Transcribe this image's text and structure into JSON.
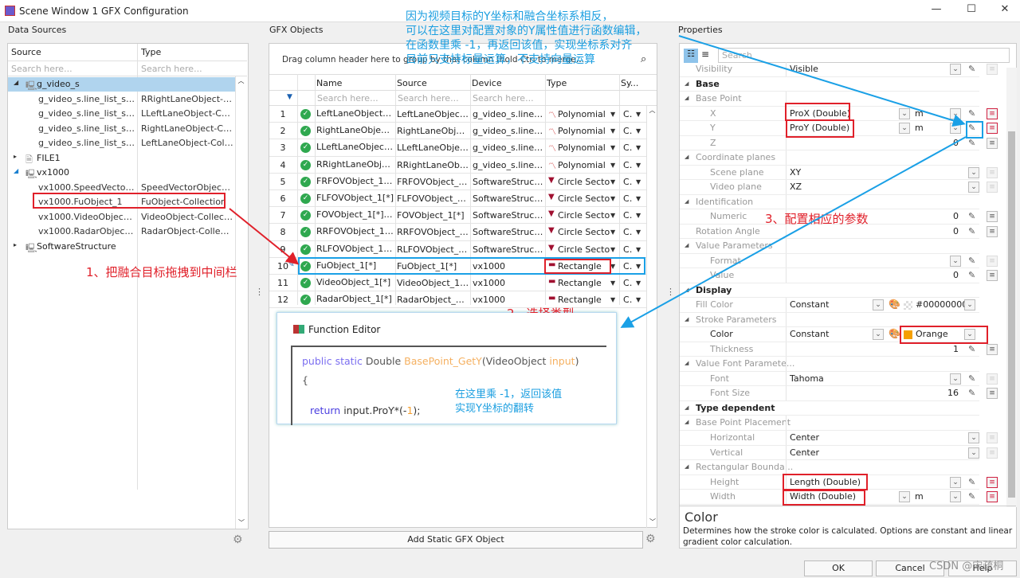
{
  "window": {
    "title": "Scene Window 1 GFX Configuration"
  },
  "data_sources": {
    "title": "Data Sources",
    "columns": [
      "Source",
      "Type"
    ],
    "search_placeholder": "Search here...",
    "tree": [
      {
        "source": "g_video_s",
        "type": "",
        "level": 0,
        "expander": "◢",
        "icon": "device",
        "selected": true
      },
      {
        "source": "g_video_s.line_list_s.li...",
        "type": "RRightLaneObject-C...",
        "level": 1
      },
      {
        "source": "g_video_s.line_list_s.li...",
        "type": "LLeftLaneObject-Col...",
        "level": 1
      },
      {
        "source": "g_video_s.line_list_s.li...",
        "type": "RightLaneObject-Col...",
        "level": 1
      },
      {
        "source": "g_video_s.line_list_s.li...",
        "type": "LeftLaneObject-Coll...",
        "level": 1
      },
      {
        "source": "FILE1",
        "type": "",
        "level": 0,
        "expander": "▸",
        "icon": "file"
      },
      {
        "source": "vx1000",
        "type": "",
        "level": 0,
        "expander": "◢",
        "icon": "device"
      },
      {
        "source": "vx1000.SpeedVector...",
        "type": "SpeedVectorObject-...",
        "level": 1
      },
      {
        "source": "vx1000.FuObject_1",
        "type": "FuObject-Collection",
        "level": 1,
        "highlighted": true
      },
      {
        "source": "vx1000.VideoObject_1",
        "type": "VideoObject-Collecti...",
        "level": 1
      },
      {
        "source": "vx1000.RadarObject_1",
        "type": "RadarObject-Collecti...",
        "level": 1
      },
      {
        "source": "SoftwareStructure",
        "type": "",
        "level": 0,
        "expander": "▸",
        "icon": "device"
      }
    ]
  },
  "gfx_objects": {
    "title": "GFX Objects",
    "group_hint": "Drag column header here to group by that column (hold Ctrl to merge groups).",
    "columns": [
      "Name",
      "Source",
      "Device",
      "Type",
      "Sy..."
    ],
    "search_placeholder": "Search here...",
    "rows": [
      {
        "n": "1",
        "name": "LeftLaneObject_1[*",
        "source": "LeftLaneObject_1",
        "device": "g_video_s.line_...",
        "type": "Polynomial",
        "sy": "Ca"
      },
      {
        "n": "2",
        "name": "RightLaneObject_1",
        "source": "RightLaneObject_",
        "device": "g_video_s.line_...",
        "type": "Polynomial",
        "sy": "Ca"
      },
      {
        "n": "3",
        "name": "LLeftLaneObject_1[",
        "source": "LLeftLaneObject_",
        "device": "g_video_s.line_...",
        "type": "Polynomial",
        "sy": "Ca"
      },
      {
        "n": "4",
        "name": "RRightLaneObject_",
        "source": "RRightLaneObjec",
        "device": "g_video_s.line_...",
        "type": "Polynomial",
        "sy": "Ca"
      },
      {
        "n": "5",
        "name": "FRFOVObject_1[*]",
        "source": "FRFOVObject_1[*]",
        "device": "SoftwareStruct...",
        "type": "Circle Secto",
        "sy": "Ca"
      },
      {
        "n": "6",
        "name": "FLFOVObject_1[*]",
        "source": "FLFOVObject_1[*]",
        "device": "SoftwareStruct...",
        "type": "Circle Secto",
        "sy": "Ca"
      },
      {
        "n": "7",
        "name": "FOVObject_1[*]_1",
        "source": "FOVObject_1[*]",
        "device": "SoftwareStruct...",
        "type": "Circle Secto",
        "sy": "Ca"
      },
      {
        "n": "8",
        "name": "RRFOVObject_1[*]_",
        "source": "RRFOVObject_1[*",
        "device": "SoftwareStruct...",
        "type": "Circle Secto",
        "sy": "Ca"
      },
      {
        "n": "9",
        "name": "RLFOVObject_1[*]_",
        "source": "RLFOVObject_1[*]",
        "device": "SoftwareStruct...",
        "type": "Circle Secto",
        "sy": "Ca"
      },
      {
        "n": "10",
        "name": "FuObject_1[*]",
        "source": "FuObject_1[*]",
        "device": "vx1000",
        "type": "Rectangle",
        "sy": "Ca",
        "selected": true
      },
      {
        "n": "11",
        "name": "VideoObject_1[*]",
        "source": "VideoObject_1[*]",
        "device": "vx1000",
        "type": "Rectangle",
        "sy": "Ca"
      },
      {
        "n": "12",
        "name": "RadarObject_1[*]",
        "source": "RadarObject_1[*]",
        "device": "vx1000",
        "type": "Rectangle",
        "sy": "Ca"
      }
    ],
    "add_button": "Add Static GFX Object"
  },
  "function_editor": {
    "title": "Function Editor",
    "sig_kw": "public static",
    "sig_type": "Double",
    "sig_name": "BasePoint_GetY",
    "sig_open": "(VideoObject ",
    "sig_param": "input",
    "sig_close": ")",
    "brace": "{",
    "ret_kw": "return",
    "ret_expr": " input.ProY*(-",
    "ret_num": "1",
    "ret_end": ");"
  },
  "properties": {
    "title": "Properties",
    "search_placeholder": "Search",
    "rows": [
      {
        "label": "Visibility",
        "value": "Visible",
        "indent": 1,
        "dd": true,
        "edit": true,
        "list": "dis"
      },
      {
        "label": "Base",
        "section": true
      },
      {
        "label": "Base Point",
        "group": true
      },
      {
        "label": "X",
        "value": "ProX (Double)",
        "indent": 2,
        "unit": "m",
        "unitdd": true,
        "dd": true,
        "edit": true,
        "list": "red"
      },
      {
        "label": "Y",
        "value": "ProY (Double)",
        "indent": 2,
        "unit": "m",
        "unitdd": true,
        "dd": true,
        "edit": true,
        "list": "red"
      },
      {
        "label": "Z",
        "num": "0",
        "indent": 2,
        "edit": true,
        "list": "on"
      },
      {
        "label": "Coordinate planes",
        "group": true
      },
      {
        "label": "Scene plane",
        "value": "XY",
        "indent": 2,
        "dd": true,
        "list": "dis"
      },
      {
        "label": "Video plane",
        "value": "XZ",
        "indent": 2,
        "dd": true,
        "list": "dis"
      },
      {
        "label": "Identification",
        "group": true
      },
      {
        "label": "Numeric",
        "num": "0",
        "indent": 2,
        "edit": true,
        "list": "on"
      },
      {
        "label": "Rotation Angle",
        "num": "0",
        "indent": 1,
        "edit": true,
        "list": "on"
      },
      {
        "label": "Value Parameters",
        "group": true
      },
      {
        "label": "Format",
        "indent": 2,
        "dd": true,
        "edit": true,
        "list": "dis"
      },
      {
        "label": "Value",
        "num": "0",
        "indent": 2,
        "edit": true,
        "list": "on"
      },
      {
        "label": "Display",
        "section": true
      },
      {
        "label": "Fill Color",
        "value": "Constant",
        "indent": 1,
        "color": "#00000000",
        "swatch": "transparent"
      },
      {
        "label": "Stroke Parameters",
        "group": true
      },
      {
        "label": "Color",
        "value": "Constant",
        "indent": 2,
        "color": "Orange",
        "swatch": "#f5a000",
        "dark": true
      },
      {
        "label": "Thickness",
        "num": "1",
        "indent": 2,
        "edit": true,
        "list": "on"
      },
      {
        "label": "Value Font Paramete...",
        "group": true
      },
      {
        "label": "Font",
        "value": "Tahoma",
        "indent": 2,
        "dd": true,
        "edit": true,
        "list": "dis"
      },
      {
        "label": "Font Size",
        "num": "16",
        "indent": 2,
        "edit": true,
        "list": "on"
      },
      {
        "label": "Type dependent",
        "section": true
      },
      {
        "label": "Base Point Placement",
        "group": true
      },
      {
        "label": "Horizontal",
        "value": "Center",
        "indent": 2,
        "dd": true,
        "list": "dis"
      },
      {
        "label": "Vertical",
        "value": "Center",
        "indent": 2,
        "dd": true,
        "list": "dis"
      },
      {
        "label": "Rectangular Bounda...",
        "group": true
      },
      {
        "label": "Height",
        "value": "Length (Double)",
        "indent": 2,
        "dd": true,
        "edit": true,
        "list": "red"
      },
      {
        "label": "Width",
        "value": "Width (Double)",
        "indent": 2,
        "unit": "m",
        "unitdd": true,
        "dd": true,
        "edit": true,
        "list": "red"
      }
    ],
    "desc_title": "Color",
    "desc_text": "Determines how the stroke color is calculated. Options are constant and linear gradient color calculation."
  },
  "buttons": {
    "ok": "OK",
    "cancel": "Cancel",
    "help": "Help"
  },
  "annotations": {
    "top": [
      "因为视频目标的Y坐标和融合坐标系相反，",
      "可以在这里对配置对象的Y属性值进行函数编辑，",
      "在函数里乘 -1，再返回该值，实现坐标系对齐",
      "目前只支持标量运算，不支持向量运算"
    ],
    "step1": "1、把融合目标拖拽到中间栏",
    "step2": "2、选择类型",
    "step3": "3、配置相应的参数",
    "editor_note": [
      "在这里乘 -1，返回该值",
      "实现Y坐标的翻转"
    ]
  },
  "watermark": "CSDN @宋疏桐"
}
